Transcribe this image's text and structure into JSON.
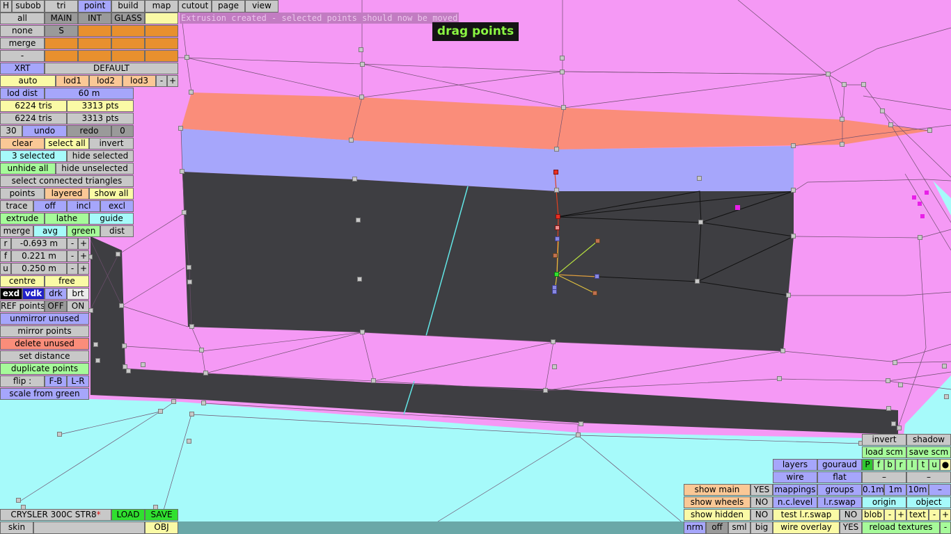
{
  "status_message": "Extrusion created - selected points should now be moved",
  "mode_label": "drag points",
  "menu": [
    "H",
    "subob",
    "tri",
    "point",
    "build",
    "map",
    "cutout",
    "page",
    "view"
  ],
  "panel": {
    "all": "all",
    "main": "MAIN",
    "int": "INT",
    "glass": "GLASS",
    "none": "none",
    "s": "S",
    "merge": "merge",
    "dash": "-",
    "xrt": "XRT",
    "default": "DEFAULT",
    "auto": "auto",
    "lod1": "lod1",
    "lod2": "lod2",
    "lod3": "lod3",
    "minus": "-",
    "plus": "+",
    "lod_dist": "lod dist",
    "lod_dist_val": "60 m",
    "tris1": "6224 tris",
    "pts1": "3313 pts",
    "tris2": "6224 tris",
    "pts2": "3313 pts",
    "undo_count": "30",
    "undo": "undo",
    "redo": "redo",
    "redo_count": "0",
    "clear": "clear",
    "select_all": "select all",
    "invert": "invert",
    "selected": "3 selected",
    "hide_selected": "hide selected",
    "unhide_all": "unhide all",
    "hide_unselected": "hide unselected",
    "select_connected": "select connected triangles",
    "points": "points",
    "layered": "layered",
    "show_all": "show all",
    "trace": "trace",
    "off": "off",
    "incl": "incl",
    "excl": "excl",
    "extrude": "extrude",
    "lathe": "lathe",
    "guide": "guide",
    "merge2": "merge",
    "avg": "avg",
    "green": "green",
    "dist": "dist",
    "r": "r",
    "r_val": "-0.693 m",
    "f": "f",
    "f_val": "0.221 m",
    "u": "u",
    "u_val": "0.250 m",
    "centre": "centre",
    "free": "free",
    "exd": "exd",
    "vdk": "vdk",
    "drk": "drk",
    "brt": "brt",
    "ref_points": "REF points",
    "ref_off": "OFF",
    "ref_on": "ON",
    "unmirror_unused": "unmirror unused",
    "mirror_points": "mirror points",
    "delete_unused": "delete unused",
    "set_distance": "set distance",
    "duplicate_points": "duplicate points",
    "flip": "flip :",
    "fb": "F-B",
    "lr": "L-R",
    "scale_from_green": "scale from green"
  },
  "footer_left": {
    "car_name": "CRYSLER 300C STR8",
    "asterisk": "*",
    "load": "LOAD",
    "save": "SAVE",
    "skin": "skin",
    "obj": "OBJ"
  },
  "bottom_right": {
    "invert": "invert",
    "shadow": "shadow",
    "load_scm": "load scm",
    "save_scm": "save scm",
    "flags": [
      "P",
      "f",
      "b",
      "r",
      "l",
      "t",
      "u"
    ],
    "dot": "●",
    "layers": "layers",
    "gouraud": "gouraud",
    "wire": "wire",
    "flat": "flat",
    "dash": "–",
    "mappings": "mappings",
    "groups": "groups",
    "d01": "0.1m",
    "d1": "1m",
    "d10": "10m",
    "minus": "–",
    "show_main": "show main",
    "yes1": "YES",
    "show_wheels": "show wheels",
    "no1": "NO",
    "nc_level": "n.c.level",
    "lr_swap": "l.r.swap",
    "origin": "origin",
    "object": "object",
    "show_hidden": "show hidden",
    "no2": "NO",
    "test_lr_swap": "test l.r.swap",
    "no3": "NO",
    "blob": "blob",
    "minus2": "-",
    "plus2": "+",
    "text": "text",
    "minus3": "-",
    "plus3": "+",
    "nrm": "nrm",
    "off": "off",
    "sml": "sml",
    "big": "big",
    "wire_overlay": "wire overlay",
    "yes2": "YES",
    "reload_textures": "reload textures",
    "minus4": "-"
  }
}
